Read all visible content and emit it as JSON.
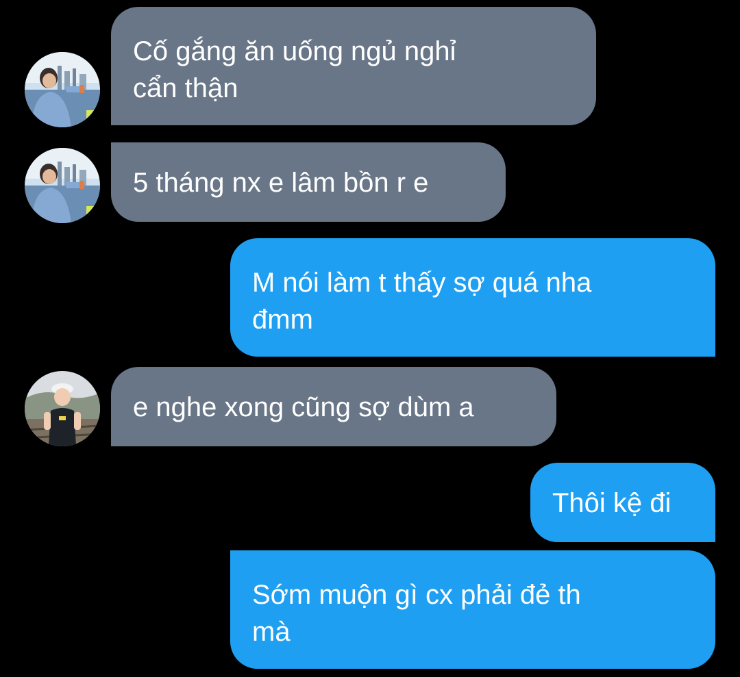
{
  "colors": {
    "background": "#000000",
    "incoming_bubble": "#687687",
    "outgoing_bubble": "#1e9ff2",
    "text": "#ffffff"
  },
  "messages": [
    {
      "sender": "incoming",
      "avatar": "avatar-man-photo",
      "text": "Cố gắng ăn uống ngủ nghỉ\ncẩn thận"
    },
    {
      "sender": "incoming",
      "avatar": "avatar-man-photo",
      "text": "5 tháng nx e lâm bồn r e"
    },
    {
      "sender": "outgoing",
      "text": "M nói làm t thấy sợ quá nha\nđmm"
    },
    {
      "sender": "incoming",
      "avatar": "avatar-child-photo",
      "text": "e nghe xong cũng sợ dùm a"
    },
    {
      "sender": "outgoing",
      "text": "Thôi kệ đi"
    },
    {
      "sender": "outgoing",
      "text": "Sớm muộn gì cx phải đẻ th\nmà"
    }
  ]
}
